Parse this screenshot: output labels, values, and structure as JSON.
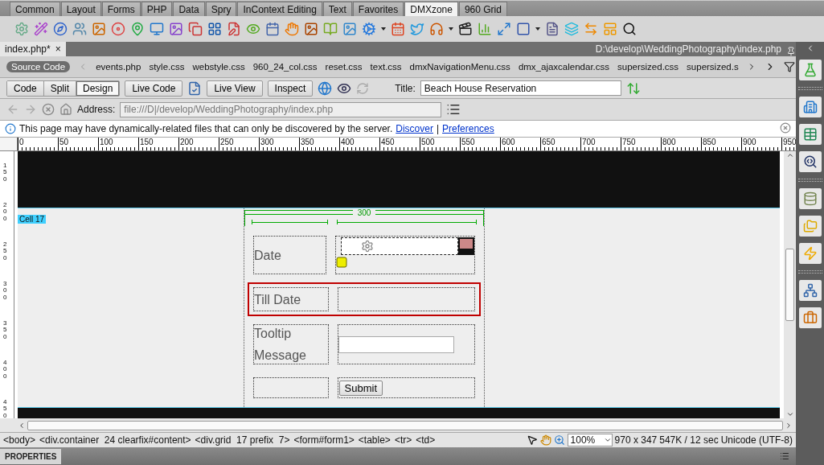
{
  "insert_bar": {
    "tabs": [
      {
        "label": "Common",
        "selected": false
      },
      {
        "label": "Layout",
        "selected": false
      },
      {
        "label": "Forms",
        "selected": false
      },
      {
        "label": "PHP",
        "selected": false
      },
      {
        "label": "Data",
        "selected": false
      },
      {
        "label": "Spry",
        "selected": false
      },
      {
        "label": "InContext Editing",
        "selected": false
      },
      {
        "label": "Text",
        "selected": false
      },
      {
        "label": "Favorites",
        "selected": false
      },
      {
        "label": "DMXzone",
        "selected": true
      },
      {
        "label": "960 Grid",
        "selected": false
      }
    ]
  },
  "document": {
    "tab": "index.php*",
    "close": "×",
    "path": "D:\\develop\\WeddingPhotography\\index.php"
  },
  "related_files": [
    {
      "label": "Source Code",
      "selected": true
    },
    {
      "label": "events.php",
      "selected": false
    },
    {
      "label": "style.css",
      "selected": false
    },
    {
      "label": "webstyle.css",
      "selected": false
    },
    {
      "label": "960_24_col.css",
      "selected": false
    },
    {
      "label": "reset.css",
      "selected": false
    },
    {
      "label": "text.css",
      "selected": false
    },
    {
      "label": "dmxNavigationMenu.css",
      "selected": false
    },
    {
      "label": "dmx_ajaxcalendar.css",
      "selected": false
    },
    {
      "label": "supersized.css",
      "selected": false
    },
    {
      "label": "supersized.s",
      "selected": false
    }
  ],
  "view_buttons": [
    {
      "label": "Code",
      "selected": false
    },
    {
      "label": "Split",
      "selected": false
    },
    {
      "label": "Design",
      "selected": true
    }
  ],
  "live_code": "Live Code",
  "live_buttons": [
    "Live View",
    "Inspect"
  ],
  "title_field": {
    "label": "Title:",
    "value": "Beach House Reservation"
  },
  "address": {
    "label": "Address:",
    "value": "file:///D|/develop/WeddingPhotography/index.php"
  },
  "info_bar": {
    "message": "This page may have dynamically-related files that can only be discovered by the server.",
    "links": [
      "Discover",
      "Preferences"
    ],
    "separator": "|"
  },
  "ruler": {
    "ticks": [
      "0",
      "50",
      "100",
      "150",
      "200",
      "250",
      "300",
      "350",
      "400",
      "450",
      "500",
      "550",
      "600",
      "650",
      "700",
      "750",
      "800",
      "850",
      "900",
      "950"
    ],
    "vertical": [
      "150",
      "200",
      "250",
      "300",
      "350",
      "400",
      "450"
    ]
  },
  "canvas": {
    "cell_tag": "Cell 17",
    "width_label": "300",
    "rows": [
      {
        "label": "Date",
        "kind": "date",
        "highlighted": false
      },
      {
        "label": "Till Date",
        "kind": "empty",
        "highlighted": true
      },
      {
        "label": "Tooltip Message",
        "kind": "text",
        "highlighted": false
      },
      {
        "kind": "button",
        "button": "Submit",
        "highlighted": false
      }
    ]
  },
  "status_bar": {
    "tags": [
      "<body>",
      "<div.container  24 clearfix#content>",
      "<div.grid  17 prefix  7>",
      "<form#form1>",
      "<table>",
      "<tr>",
      "<td>"
    ],
    "zoom": "100%",
    "size": "970 x 347",
    "download": "547K / 12 sec",
    "encoding": "Unicode (UTF-8)"
  },
  "properties": {
    "title": "PROPERTIES"
  }
}
